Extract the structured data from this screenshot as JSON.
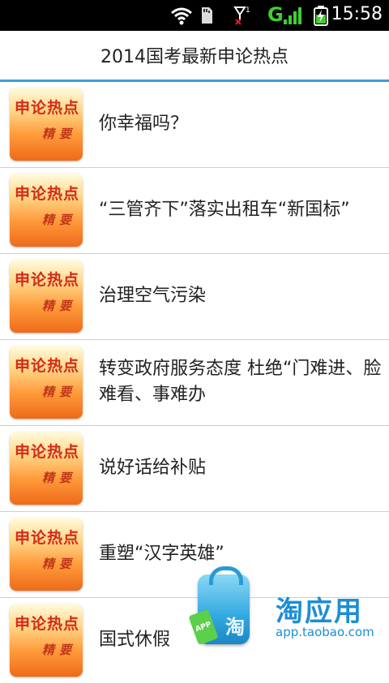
{
  "status_bar": {
    "time": "15:58",
    "icons": [
      "wifi-icon",
      "sd-card-icon",
      "no-signal-icon",
      "3g-signal-icon",
      "battery-charging-icon"
    ],
    "network_label": "G"
  },
  "title": "2014国考最新申论热点",
  "thumbnail": {
    "line1": "申论热点",
    "line2": "精要"
  },
  "items": [
    {
      "text": "你幸福吗？"
    },
    {
      "text": "“三管齐下”落实出租车“新国标”"
    },
    {
      "text": "治理空气污染"
    },
    {
      "text": "转变政府服务态度 杜绝“门难进、脸难看、事难办"
    },
    {
      "text": "说好话给补贴"
    },
    {
      "text": "重塑“汉字英雄”"
    },
    {
      "text": "国式休假"
    }
  ],
  "taobao_badge": {
    "name": "淘应用",
    "url": "app.taobao.com",
    "tag": "APP",
    "glyph": "淘"
  },
  "colors": {
    "accent": "#3c9ed8",
    "taobao_blue": "#1b8ed6",
    "thumb_orange": "#ee6a1a"
  }
}
